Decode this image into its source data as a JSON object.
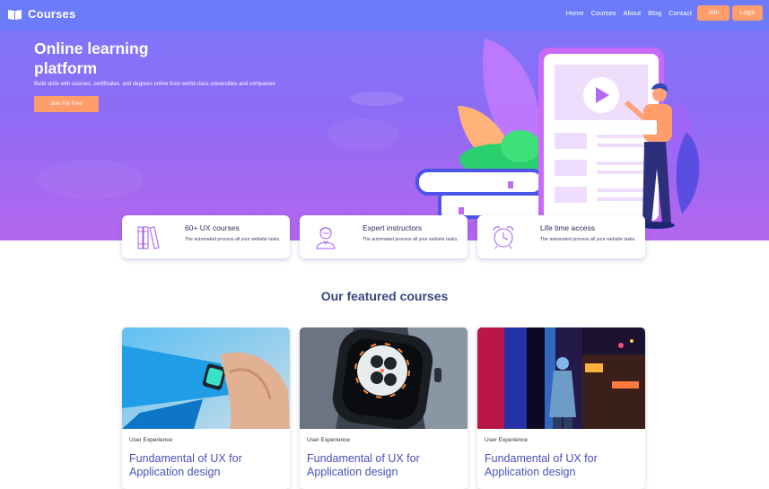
{
  "brand": {
    "name": "Courses"
  },
  "nav": {
    "links": [
      "Home",
      "Courses",
      "About",
      "Blog",
      "Contact"
    ],
    "join": "Join",
    "login": "Login"
  },
  "hero": {
    "title": "Online learning platform",
    "subtitle": "Build skills with courses, certificates, and degrees online from world-class universities and companies",
    "cta": "Join For Free"
  },
  "features": [
    {
      "title": "60+ UX courses",
      "desc": "The automated process all your website tasks.",
      "icon": "books-icon"
    },
    {
      "title": "Expert instructors",
      "desc": "The automated process all your website tasks.",
      "icon": "instructor-icon"
    },
    {
      "title": "Life time access",
      "desc": "The automated process all your website tasks.",
      "icon": "alarm-clock-icon"
    }
  ],
  "section": {
    "title": "Our featured courses"
  },
  "courses": [
    {
      "category": "User Experience",
      "title": "Fundamental of UX for Application design",
      "image": "smartwatch-wrist-photo"
    },
    {
      "category": "User Experience",
      "title": "Fundamental of UX for Application design",
      "image": "smartwatch-closeup-photo"
    },
    {
      "category": "User Experience",
      "title": "Fundamental of UX for Application design",
      "image": "neon-city-person-photo"
    }
  ],
  "colors": {
    "accent": "#ff9d6b",
    "nav": "#6b7bf9",
    "heroTop": "#7b78fb",
    "heroBottom": "#b466ee",
    "courseTitle": "#4a51b5"
  }
}
